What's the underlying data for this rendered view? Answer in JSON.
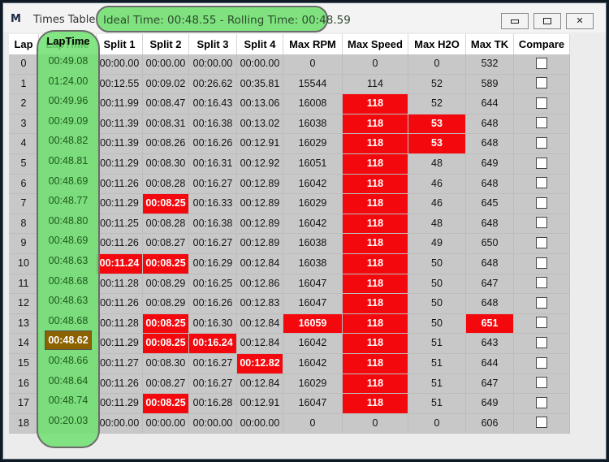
{
  "window": {
    "title": "Times Table",
    "highlight_text": "Ideal Time: 00:48.55 - Rolling Time: 00:48.59",
    "app_icon": "M",
    "controls": [
      "minimize-icon",
      "maximize-icon",
      "close-icon"
    ]
  },
  "columns": [
    "Lap",
    "LapTime",
    "Split 1",
    "Split 2",
    "Split 3",
    "Split 4",
    "Max RPM",
    "Max Speed",
    "Max H2O",
    "Max TK",
    "Compare"
  ],
  "rows": [
    {
      "lap": "0",
      "laptime": "00:49.08",
      "s1": "00:00.00",
      "s2": "00:00.00",
      "s3": "00:00.00",
      "s4": "00:00.00",
      "rpm": "0",
      "speed": "0",
      "h2o": "0",
      "tk": "532",
      "hot": []
    },
    {
      "lap": "1",
      "laptime": "01:24.00",
      "s1": "00:12.55",
      "s2": "00:09.02",
      "s3": "00:26.62",
      "s4": "00:35.81",
      "rpm": "15544",
      "speed": "114",
      "h2o": "52",
      "tk": "589",
      "hot": []
    },
    {
      "lap": "2",
      "laptime": "00:49.96",
      "s1": "00:11.99",
      "s2": "00:08.47",
      "s3": "00:16.43",
      "s4": "00:13.06",
      "rpm": "16008",
      "speed": "118",
      "h2o": "52",
      "tk": "644",
      "hot": [
        "speed"
      ]
    },
    {
      "lap": "3",
      "laptime": "00:49.09",
      "s1": "00:11.39",
      "s2": "00:08.31",
      "s3": "00:16.38",
      "s4": "00:13.02",
      "rpm": "16038",
      "speed": "118",
      "h2o": "53",
      "tk": "648",
      "hot": [
        "speed",
        "h2o"
      ]
    },
    {
      "lap": "4",
      "laptime": "00:48.82",
      "s1": "00:11.39",
      "s2": "00:08.26",
      "s3": "00:16.26",
      "s4": "00:12.91",
      "rpm": "16029",
      "speed": "118",
      "h2o": "53",
      "tk": "648",
      "hot": [
        "speed",
        "h2o"
      ]
    },
    {
      "lap": "5",
      "laptime": "00:48.81",
      "s1": "00:11.29",
      "s2": "00:08.30",
      "s3": "00:16.31",
      "s4": "00:12.92",
      "rpm": "16051",
      "speed": "118",
      "h2o": "48",
      "tk": "649",
      "hot": [
        "speed"
      ]
    },
    {
      "lap": "6",
      "laptime": "00:48.69",
      "s1": "00:11.26",
      "s2": "00:08.28",
      "s3": "00:16.27",
      "s4": "00:12.89",
      "rpm": "16042",
      "speed": "118",
      "h2o": "46",
      "tk": "648",
      "hot": [
        "speed"
      ]
    },
    {
      "lap": "7",
      "laptime": "00:48.77",
      "s1": "00:11.29",
      "s2": "00:08.25",
      "s3": "00:16.33",
      "s4": "00:12.89",
      "rpm": "16029",
      "speed": "118",
      "h2o": "46",
      "tk": "645",
      "hot": [
        "s2",
        "speed"
      ]
    },
    {
      "lap": "8",
      "laptime": "00:48.80",
      "s1": "00:11.25",
      "s2": "00:08.28",
      "s3": "00:16.38",
      "s4": "00:12.89",
      "rpm": "16042",
      "speed": "118",
      "h2o": "48",
      "tk": "648",
      "hot": [
        "speed"
      ]
    },
    {
      "lap": "9",
      "laptime": "00:48.69",
      "s1": "00:11.26",
      "s2": "00:08.27",
      "s3": "00:16.27",
      "s4": "00:12.89",
      "rpm": "16038",
      "speed": "118",
      "h2o": "49",
      "tk": "650",
      "hot": [
        "speed"
      ]
    },
    {
      "lap": "10",
      "laptime": "00:48.63",
      "s1": "00:11.24",
      "s2": "00:08.25",
      "s3": "00:16.29",
      "s4": "00:12.84",
      "rpm": "16038",
      "speed": "118",
      "h2o": "50",
      "tk": "648",
      "hot": [
        "s1",
        "s2",
        "speed"
      ]
    },
    {
      "lap": "11",
      "laptime": "00:48.68",
      "s1": "00:11.28",
      "s2": "00:08.29",
      "s3": "00:16.25",
      "s4": "00:12.86",
      "rpm": "16047",
      "speed": "118",
      "h2o": "50",
      "tk": "647",
      "hot": [
        "speed"
      ]
    },
    {
      "lap": "12",
      "laptime": "00:48.63",
      "s1": "00:11.26",
      "s2": "00:08.29",
      "s3": "00:16.26",
      "s4": "00:12.83",
      "rpm": "16047",
      "speed": "118",
      "h2o": "50",
      "tk": "648",
      "hot": [
        "speed"
      ]
    },
    {
      "lap": "13",
      "laptime": "00:48.68",
      "s1": "00:11.28",
      "s2": "00:08.25",
      "s3": "00:16.30",
      "s4": "00:12.84",
      "rpm": "16059",
      "speed": "118",
      "h2o": "50",
      "tk": "651",
      "hot": [
        "s2",
        "rpm",
        "speed",
        "tk"
      ]
    },
    {
      "lap": "14",
      "laptime": "00:48.62",
      "s1": "00:11.29",
      "s2": "00:08.25",
      "s3": "00:16.24",
      "s4": "00:12.84",
      "rpm": "16042",
      "speed": "118",
      "h2o": "51",
      "tk": "643",
      "hot": [
        "s2",
        "s3",
        "speed"
      ],
      "best": true
    },
    {
      "lap": "15",
      "laptime": "00:48.66",
      "s1": "00:11.27",
      "s2": "00:08.30",
      "s3": "00:16.27",
      "s4": "00:12.82",
      "rpm": "16042",
      "speed": "118",
      "h2o": "51",
      "tk": "644",
      "hot": [
        "s4",
        "speed"
      ]
    },
    {
      "lap": "16",
      "laptime": "00:48.64",
      "s1": "00:11.26",
      "s2": "00:08.27",
      "s3": "00:16.27",
      "s4": "00:12.84",
      "rpm": "16029",
      "speed": "118",
      "h2o": "51",
      "tk": "647",
      "hot": [
        "speed"
      ]
    },
    {
      "lap": "17",
      "laptime": "00:48.74",
      "s1": "00:11.29",
      "s2": "00:08.25",
      "s3": "00:16.28",
      "s4": "00:12.91",
      "rpm": "16047",
      "speed": "118",
      "h2o": "51",
      "tk": "649",
      "hot": [
        "s2",
        "speed"
      ]
    },
    {
      "lap": "18",
      "laptime": "00:20.03",
      "s1": "00:00.00",
      "s2": "00:00.00",
      "s3": "00:00.00",
      "s4": "00:00.00",
      "rpm": "0",
      "speed": "0",
      "h2o": "0",
      "tk": "606",
      "hot": []
    }
  ],
  "colors": {
    "hot": "#f3090d",
    "best_lap": "#8a6200",
    "highlight_green": "#7fe27f"
  }
}
